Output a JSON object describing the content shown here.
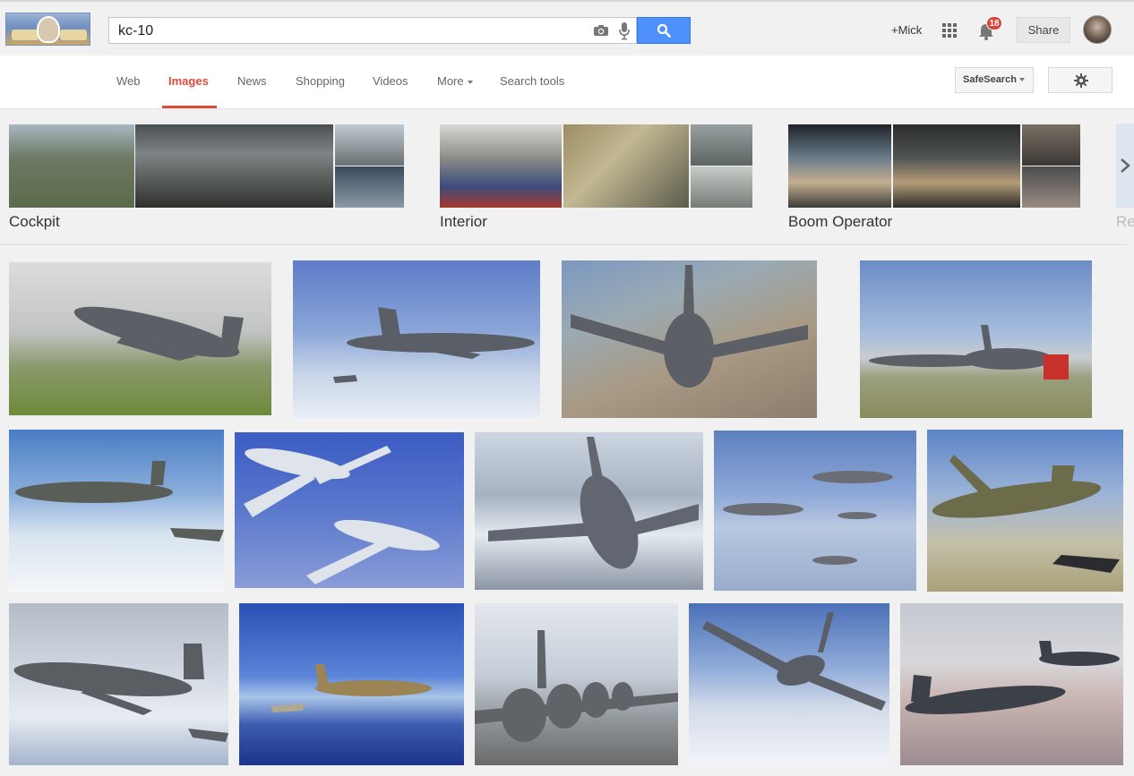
{
  "search": {
    "query": "kc-10"
  },
  "header": {
    "profile_link": "+Mick",
    "notification_count": "18",
    "share_label": "Share"
  },
  "tabs": [
    {
      "label": "Web"
    },
    {
      "label": "Images"
    },
    {
      "label": "News"
    },
    {
      "label": "Shopping"
    },
    {
      "label": "Videos"
    },
    {
      "label": "More"
    },
    {
      "label": "Search tools"
    }
  ],
  "tools": {
    "safesearch_label": "SafeSearch"
  },
  "related_searches": [
    {
      "label": "Cockpit"
    },
    {
      "label": "Interior"
    },
    {
      "label": "Boom Operator"
    },
    {
      "label": "Re"
    }
  ],
  "colors": {
    "accent_red": "#dd4b39",
    "search_blue": "#4d90fe",
    "badge_red": "#db4437"
  },
  "icons": [
    "camera-icon",
    "microphone-icon",
    "search-icon",
    "apps-grid-icon",
    "bell-icon",
    "gear-icon",
    "chevron-right-icon"
  ]
}
